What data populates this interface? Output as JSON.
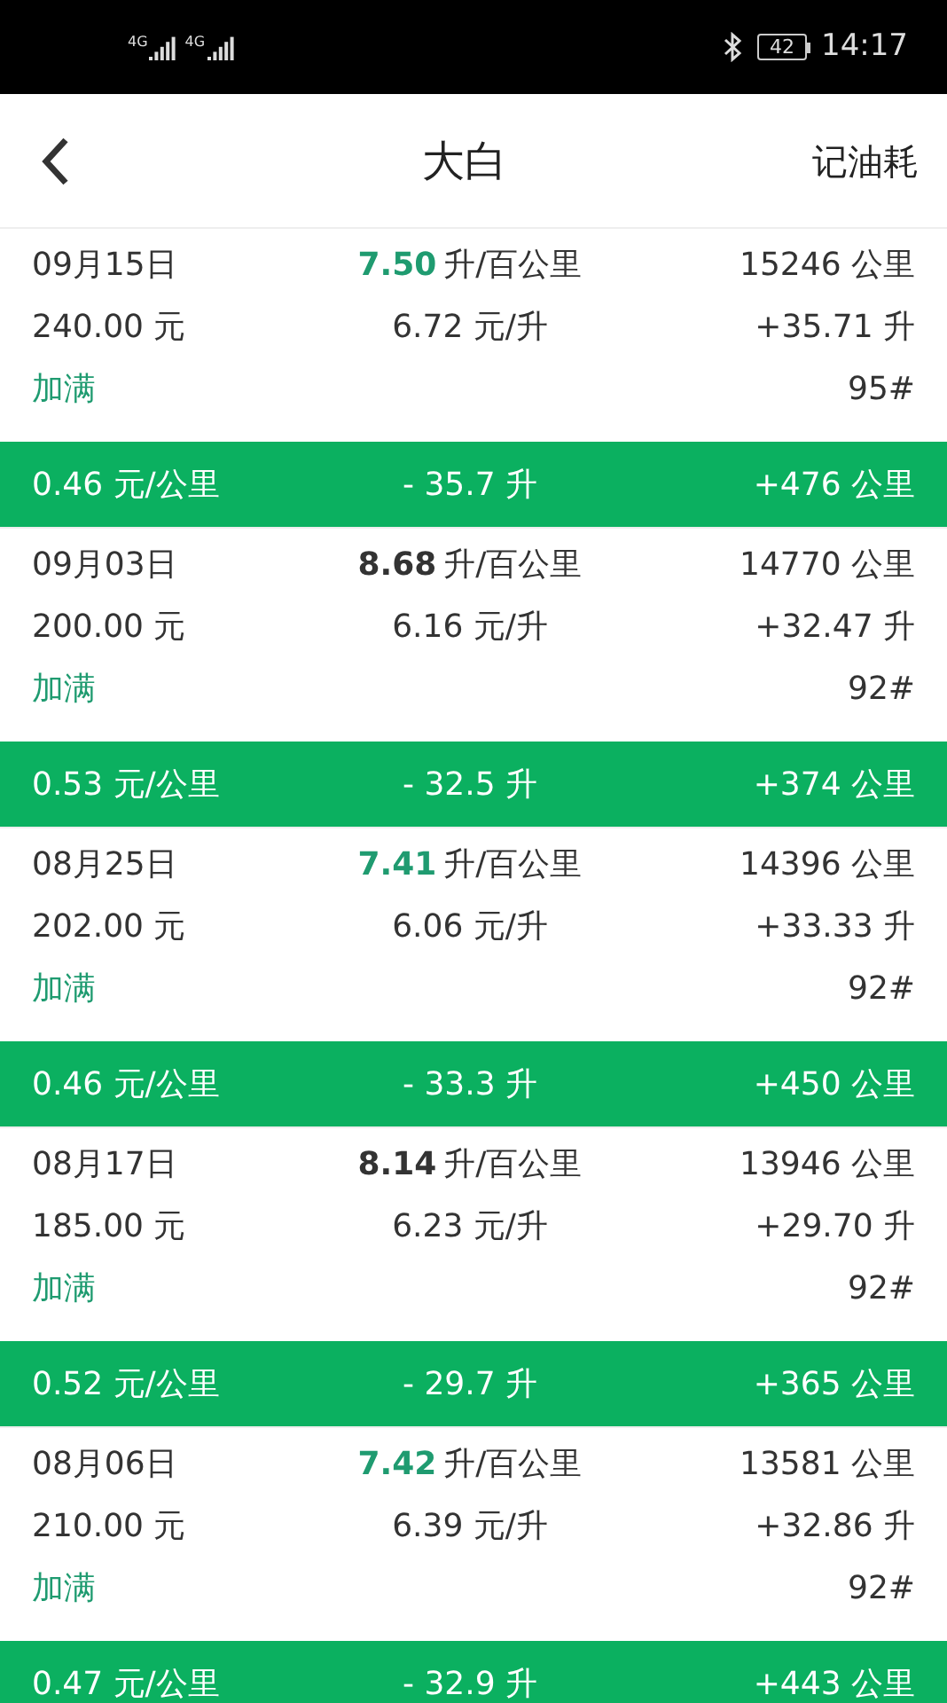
{
  "status_bar": {
    "networks": [
      "4G",
      "4G"
    ],
    "battery": "42",
    "time": "14:17"
  },
  "header": {
    "title": "大白",
    "action": "记油耗"
  },
  "records": [
    {
      "date": "09月15日",
      "consumption": "7.50",
      "consumption_unit": "升/百公里",
      "color": "#1f9b70",
      "odometer": "15246 公里",
      "cost": "240.00 元",
      "price": "6.72 元/升",
      "volume": "+35.71 升",
      "fill_type": "加满",
      "grade": "95#",
      "summary": {
        "cost_per_km": "0.46 元/公里",
        "used": "- 35.7 升",
        "distance": "+476 公里"
      }
    },
    {
      "date": "09月03日",
      "consumption": "8.68",
      "consumption_unit": "升/百公里",
      "color": "#333333",
      "odometer": "14770 公里",
      "cost": "200.00 元",
      "price": "6.16 元/升",
      "volume": "+32.47 升",
      "fill_type": "加满",
      "grade": "92#",
      "summary": {
        "cost_per_km": "0.53 元/公里",
        "used": "- 32.5 升",
        "distance": "+374 公里"
      }
    },
    {
      "date": "08月25日",
      "consumption": "7.41",
      "consumption_unit": "升/百公里",
      "color": "#1f9b70",
      "odometer": "14396 公里",
      "cost": "202.00 元",
      "price": "6.06 元/升",
      "volume": "+33.33 升",
      "fill_type": "加满",
      "grade": "92#",
      "summary": {
        "cost_per_km": "0.46 元/公里",
        "used": "- 33.3 升",
        "distance": "+450 公里"
      }
    },
    {
      "date": "08月17日",
      "consumption": "8.14",
      "consumption_unit": "升/百公里",
      "color": "#333333",
      "odometer": "13946 公里",
      "cost": "185.00 元",
      "price": "6.23 元/升",
      "volume": "+29.70 升",
      "fill_type": "加满",
      "grade": "92#",
      "summary": {
        "cost_per_km": "0.52 元/公里",
        "used": "- 29.7 升",
        "distance": "+365 公里"
      }
    },
    {
      "date": "08月06日",
      "consumption": "7.42",
      "consumption_unit": "升/百公里",
      "color": "#1f9b70",
      "odometer": "13581 公里",
      "cost": "210.00 元",
      "price": "6.39 元/升",
      "volume": "+32.86 升",
      "fill_type": "加满",
      "grade": "92#",
      "summary": {
        "cost_per_km": "0.47 元/公里",
        "used": "- 32.9 升",
        "distance": "+443 公里"
      }
    }
  ]
}
